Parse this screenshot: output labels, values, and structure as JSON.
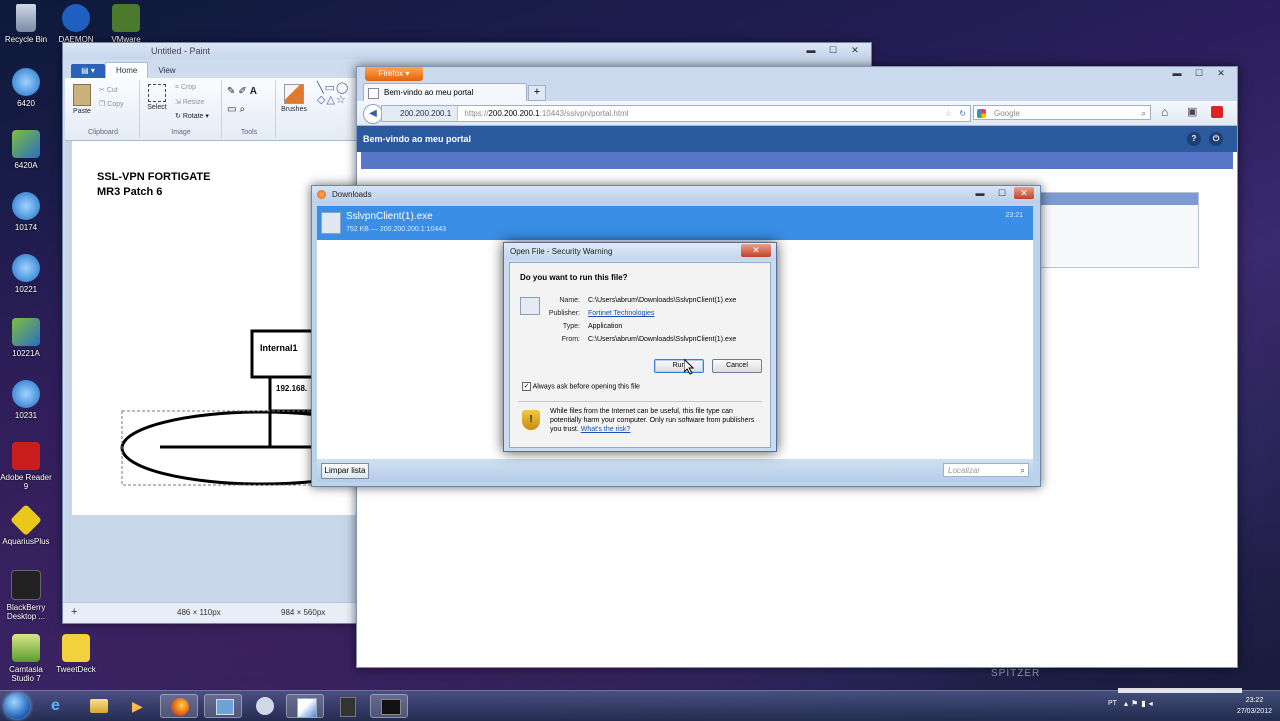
{
  "desktop": {
    "icons": [
      {
        "label": "Recycle Bin"
      },
      {
        "label": "DAEMON"
      },
      {
        "label": "VMware"
      },
      {
        "label": "6420"
      },
      {
        "label": "6420A"
      },
      {
        "label": "10174"
      },
      {
        "label": "10221"
      },
      {
        "label": "10221A"
      },
      {
        "label": "10231"
      },
      {
        "label": "Adobe Reader 9"
      },
      {
        "label": "AquariusPlus"
      },
      {
        "label": "BlackBerry Desktop ..."
      },
      {
        "label": "Camtasia Studio 7"
      },
      {
        "label": "TweetDeck"
      }
    ],
    "watermark": "SPITZER"
  },
  "paint": {
    "title": "Untitled - Paint",
    "tabs": {
      "home": "Home",
      "view": "View"
    },
    "ribbon": {
      "paste": "Paste",
      "cut": "Cut",
      "copy": "Copy",
      "clipboard": "Clipboard",
      "select": "Select",
      "crop": "Crop",
      "resize": "Resize",
      "rotate": "Rotate ▾",
      "image": "Image",
      "tools": "Tools",
      "brushes": "Brushes"
    },
    "canvas": {
      "line1": "SSL-VPN FORTIGATE",
      "line2": "MR3 Patch 6",
      "box_label": "Internal1",
      "ip_label": "192.168."
    },
    "status": {
      "selection": "486 × 110px",
      "size": "984 × 560px"
    }
  },
  "firefox": {
    "menu_button": "Firefox ▾",
    "tab_title": "Bem-vindo ao meu portal",
    "new_tab": "+",
    "url_site": "200.200.200.1",
    "url_prefix": "https://",
    "url_host": "200.200.200.1",
    "url_path": ":10443/sslvpn/portal.html",
    "search_placeholder": "Google",
    "portal_header": "Bem-vindo ao meu portal"
  },
  "downloads": {
    "title": "Downloads",
    "file_name": "SslvpnClient(1).exe",
    "file_info": "752 KB — 200.200.200.1:10443",
    "time": "23:21",
    "clear_button": "Limpar lista",
    "search_placeholder": "Localizar"
  },
  "security_dialog": {
    "title": "Open File - Security Warning",
    "question": "Do you want to run this file?",
    "fields": {
      "name_label": "Name:",
      "name_value": "C:\\Users\\abrum\\Downloads\\SslvpnClient(1).exe",
      "publisher_label": "Publisher:",
      "publisher_value": "Fortinet Technologies",
      "type_label": "Type:",
      "type_value": "Application",
      "from_label": "From:",
      "from_value": "C:\\Users\\abrum\\Downloads\\SslvpnClient(1).exe"
    },
    "run_button": "Run",
    "cancel_button": "Cancel",
    "always_ask": "Always ask before opening this file",
    "warning_text": "While files from the Internet can be useful, this file type can potentially harm your computer. Only run software from publishers you trust.",
    "risk_link": "What's the risk?"
  },
  "taskbar": {
    "lang": "PT",
    "time": "23:22",
    "date": "27/03/2012"
  }
}
